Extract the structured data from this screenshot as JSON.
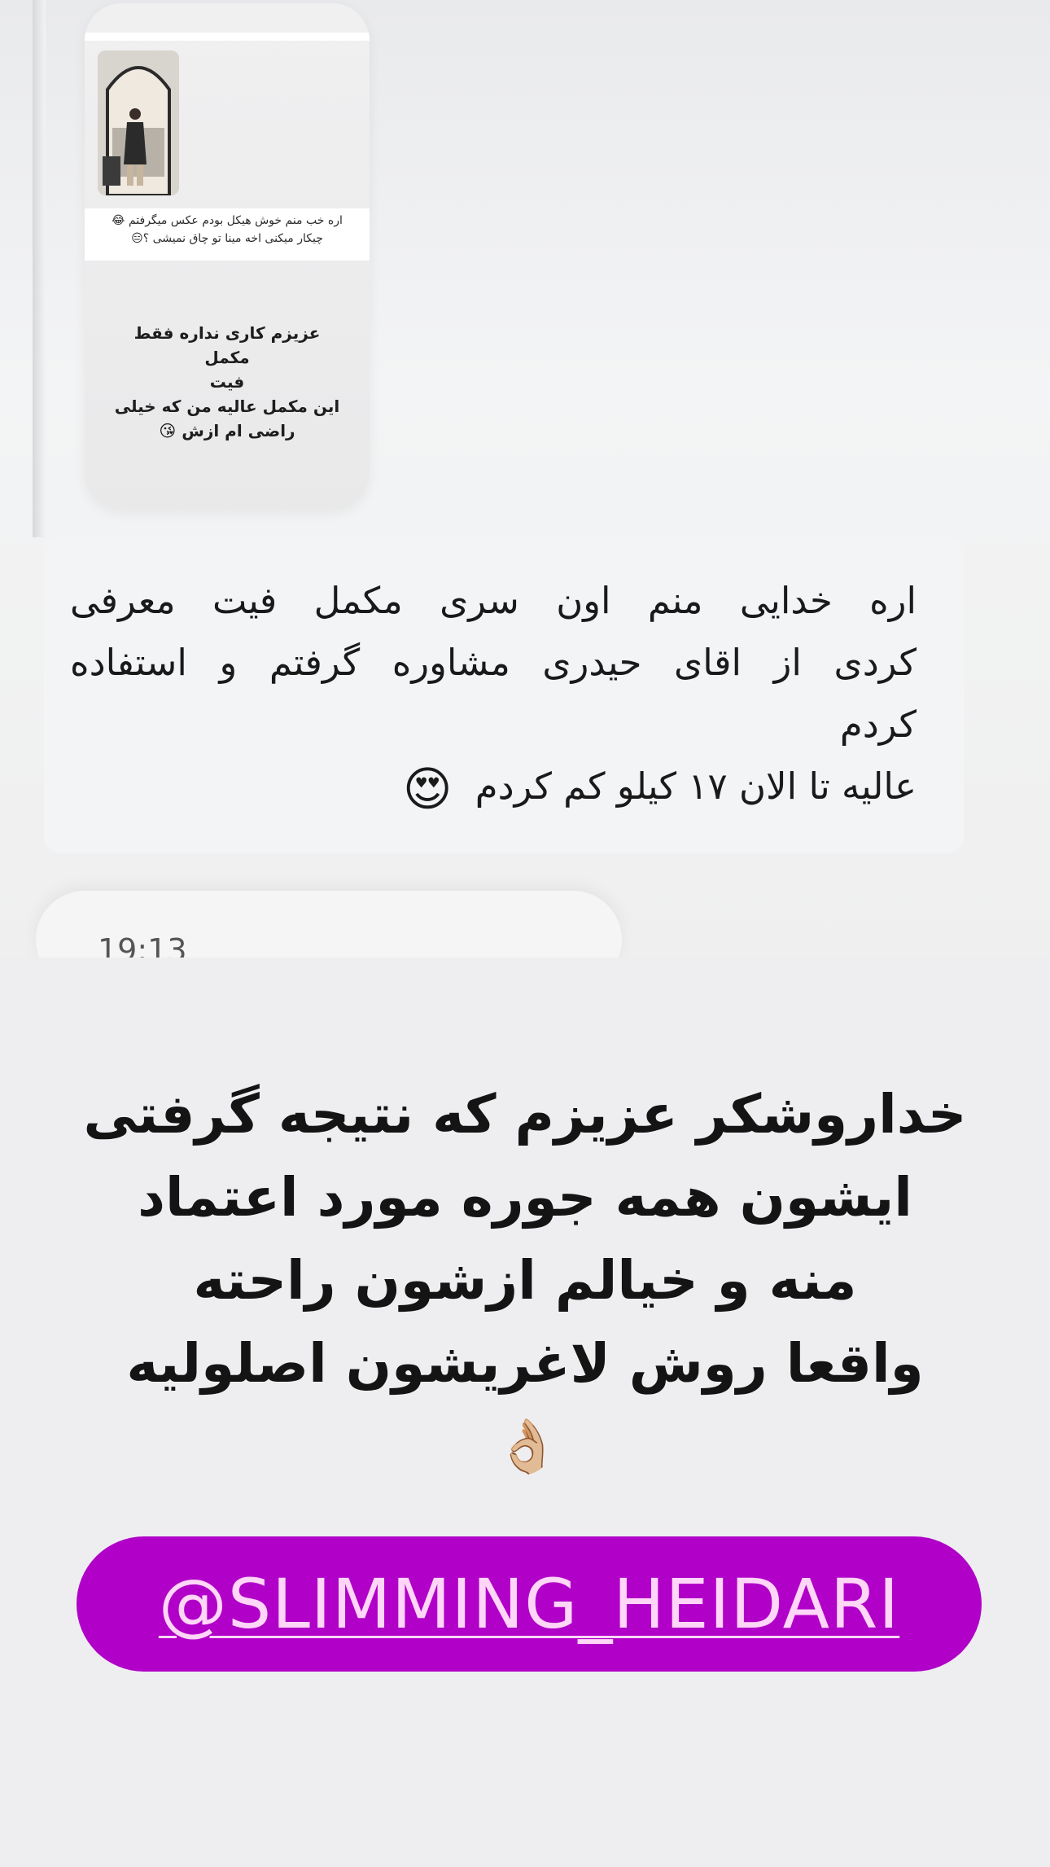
{
  "story": {
    "caption_line1": "اره خب منم خوش هیکل بودم عکس میگرفتم 😂",
    "caption_line2": "چیکار میکنی اخه مینا تو چاق نمیشی ؟😑",
    "reply_line1": "عزیزم کاری نداره فقط مکمل",
    "reply_line2": "فیت",
    "reply_line3": "این مکمل عالیه من که خیلی",
    "reply_line4": "راضی ام ازش 😘"
  },
  "chat": {
    "line1": "اره خدایی منم اون سری مکمل فیت معرفی",
    "line2": "کردی از اقای حیدری مشاوره گرفتم و استفاده",
    "line3": "کردم",
    "line4": "عالیه تا الان ۱۷ کیلو کم کردم",
    "emoji": "😍",
    "next_timestamp": "19:13"
  },
  "headline": {
    "line1": "خداروشکر عزیزم که نتیجه گرفتی",
    "line2": "ایشون همه جوره مورد اعتماد",
    "line3": "منه و خیالم ازشون راحته",
    "line4": "واقعا روش لاغریشون اصلولیه",
    "emoji": "👌🏼"
  },
  "cta": {
    "handle": "@SLIMMING_HEIDARI",
    "pill_color": "#b100c8"
  }
}
